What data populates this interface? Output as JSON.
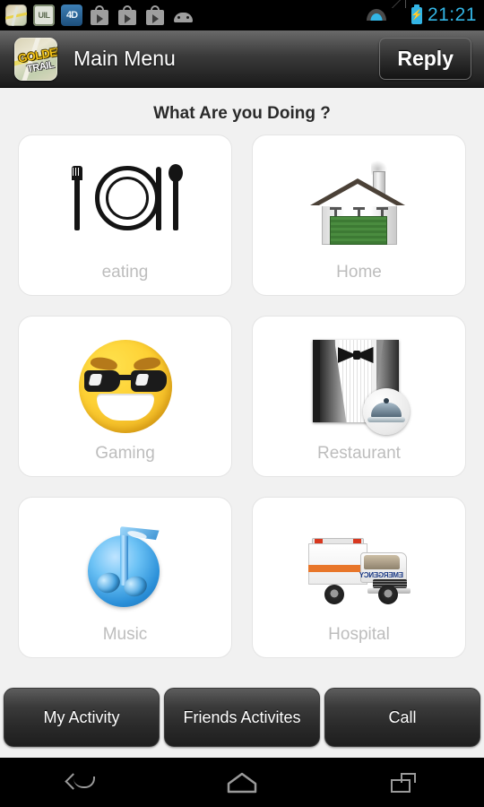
{
  "statusbar": {
    "notification_icons": [
      "golden-trail-icon",
      "uil-icon",
      "4d-icon",
      "play-store-icon",
      "play-store-icon",
      "play-store-icon",
      "android-icon"
    ],
    "uil_label": "UIL",
    "fourd_label": "4D",
    "wifi_icon": "wifi-icon",
    "signal_icon": "signal-icon",
    "battery_icon": "battery-charging-icon",
    "battery_bolt": "⚡",
    "clock": "21:21",
    "accent_color": "#33b5e5"
  },
  "actionbar": {
    "app_icon_name": "golden-trail-app-icon",
    "app_icon_text_top": "GOLDEN",
    "app_icon_text_bottom": "TRAIL",
    "title": "Main Menu",
    "reply_label": "Reply"
  },
  "main": {
    "question": "What Are you Doing ?",
    "cards": [
      {
        "label": "eating",
        "icon": "dinner-place-setting-icon"
      },
      {
        "label": "Home",
        "icon": "house-icon"
      },
      {
        "label": "Gaming",
        "icon": "sunglasses-smiley-icon"
      },
      {
        "label": "Restaurant",
        "icon": "tuxedo-cloche-icon"
      },
      {
        "label": "Music",
        "icon": "music-note-icon"
      },
      {
        "label": "Hospital",
        "icon": "ambulance-icon"
      }
    ],
    "ambulance_text": "EMERGENCY",
    "label_color": "#bdbdbd",
    "background_color": "#f1f1f1"
  },
  "bottom_buttons": [
    {
      "label": "My Activity"
    },
    {
      "label": "Friends Activites"
    },
    {
      "label": "Call"
    }
  ],
  "navbar": {
    "back": "back-icon",
    "home": "home-icon",
    "recents": "recents-icon"
  }
}
